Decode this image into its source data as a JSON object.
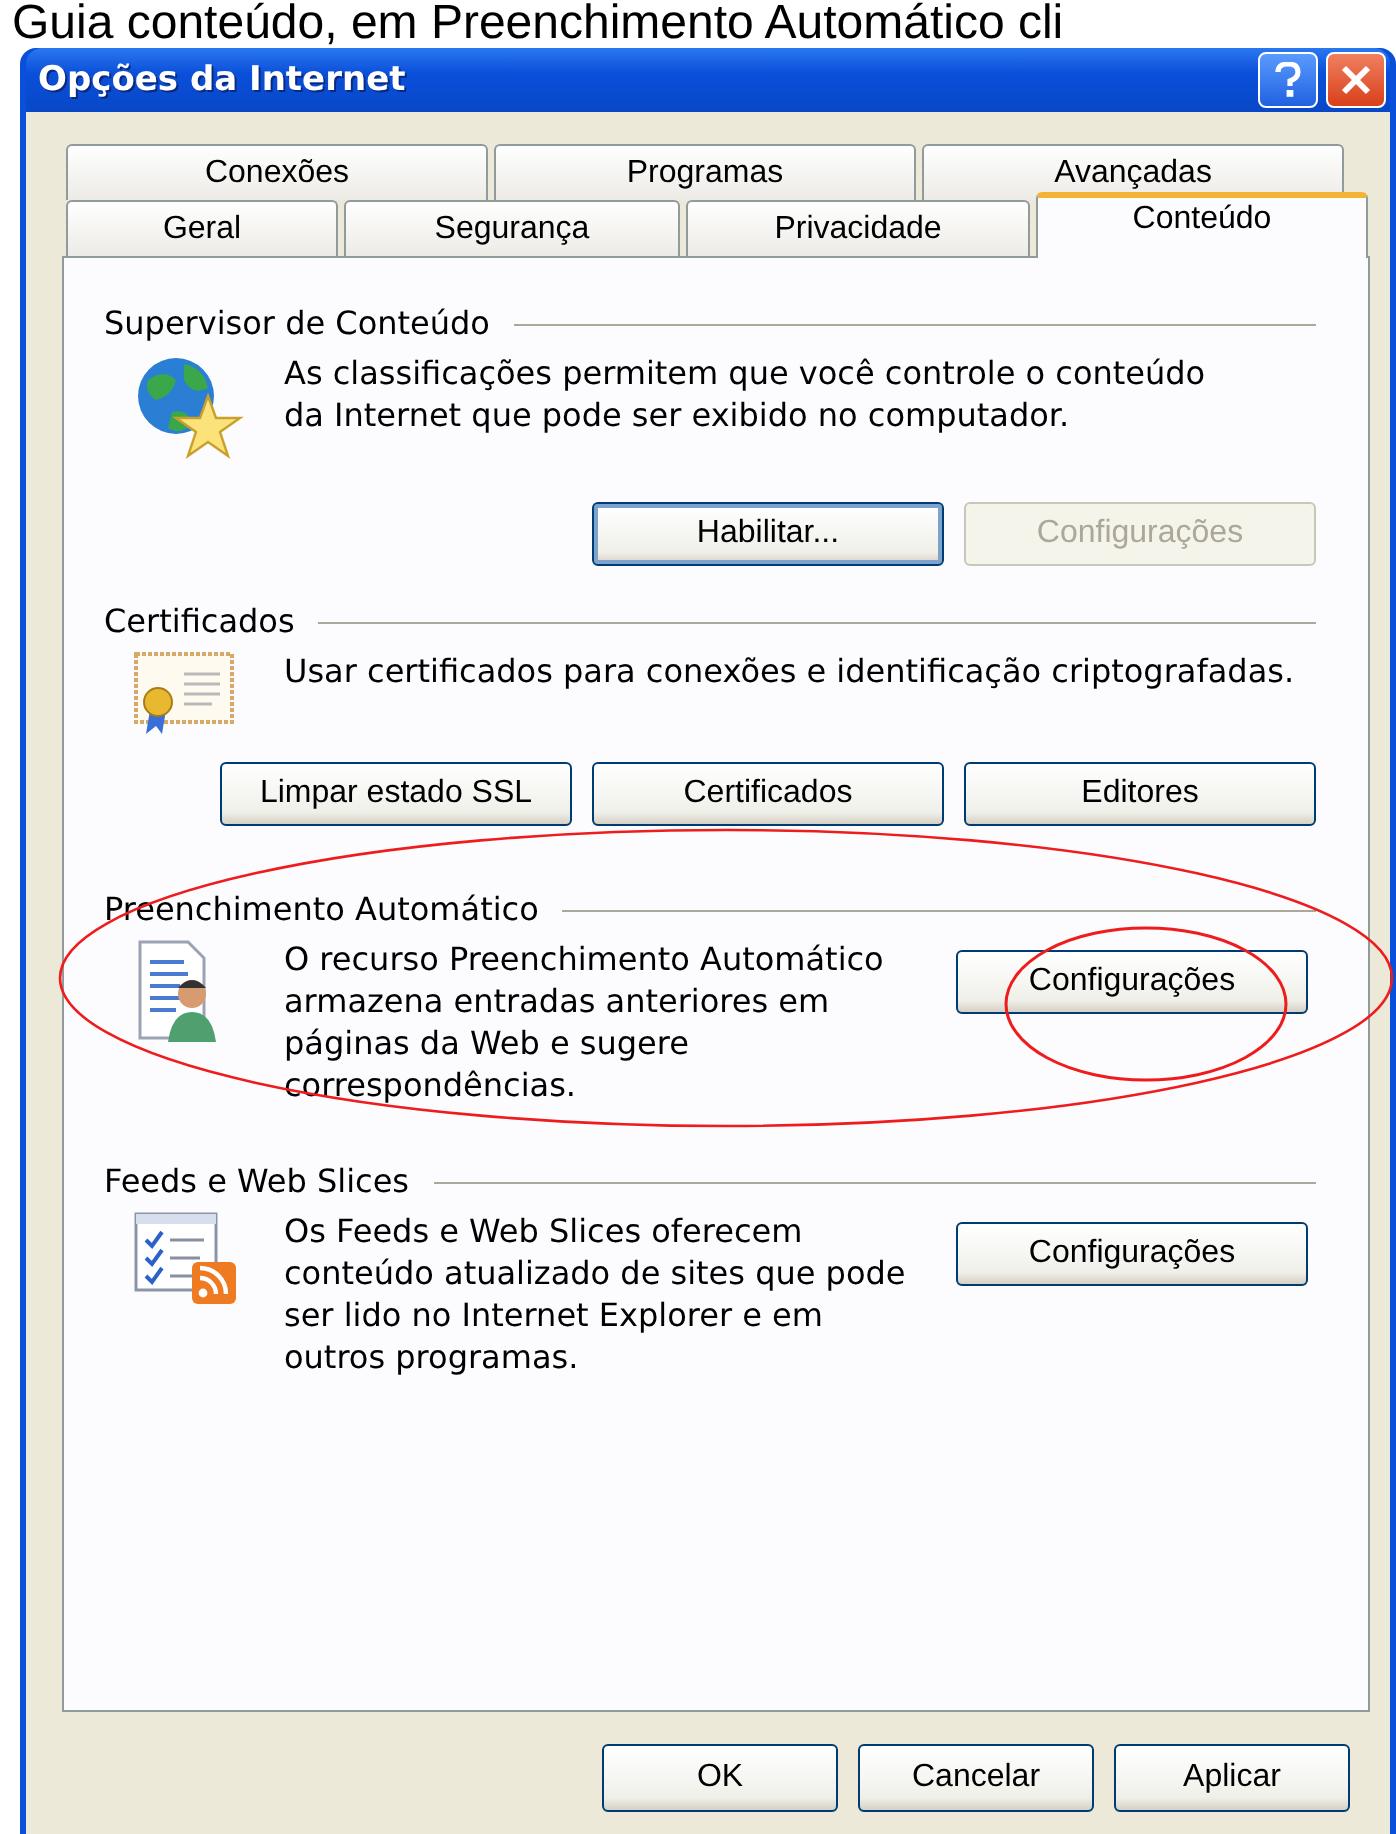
{
  "caption": "Guia conteúdo, em Preenchimento Automático cli",
  "window": {
    "title": "Opções da Internet"
  },
  "tab_rows": [
    [
      {
        "label": "Conexões",
        "selected": false
      },
      {
        "label": "Programas",
        "selected": false
      },
      {
        "label": "Avançadas",
        "selected": false
      }
    ],
    [
      {
        "label": "Geral",
        "selected": false
      },
      {
        "label": "Segurança",
        "selected": false
      },
      {
        "label": "Privacidade",
        "selected": false
      },
      {
        "label": "Conteúdo",
        "selected": true
      }
    ]
  ],
  "sections": [
    {
      "kind": "advisor",
      "title": "Supervisor de Conteúdo",
      "description": "As classificações permitem que você controle o conteúdo da Internet que pode ser exibido no computador.",
      "buttons": [
        {
          "label": "Habilitar...",
          "disabled": false,
          "focused": true
        },
        {
          "label": "Configurações",
          "disabled": true,
          "focused": false
        }
      ]
    },
    {
      "kind": "certificates",
      "title": "Certificados",
      "description": "Usar certificados para conexões e identificação criptografadas.",
      "buttons": [
        {
          "label": "Limpar estado SSL",
          "disabled": false,
          "focused": false
        },
        {
          "label": "Certificados",
          "disabled": false,
          "focused": false
        },
        {
          "label": "Editores",
          "disabled": false,
          "focused": false
        }
      ]
    },
    {
      "kind": "autofill",
      "title": "Preenchimento Automático",
      "description": "O recurso Preenchimento Automático armazena entradas anteriores em páginas da Web e sugere correspondências.",
      "buttons": [
        {
          "label": "Configurações",
          "disabled": false,
          "focused": false
        }
      ]
    },
    {
      "kind": "feeds",
      "title": "Feeds e Web Slices",
      "description": "Os Feeds e Web Slices oferecem conteúdo atualizado de sites que pode ser lido no Internet Explorer e em outros programas.",
      "buttons": [
        {
          "label": "Configurações",
          "disabled": false,
          "focused": false
        }
      ]
    }
  ],
  "dialog_buttons": [
    {
      "label": "OK"
    },
    {
      "label": "Cancelar"
    },
    {
      "label": "Aplicar"
    }
  ]
}
